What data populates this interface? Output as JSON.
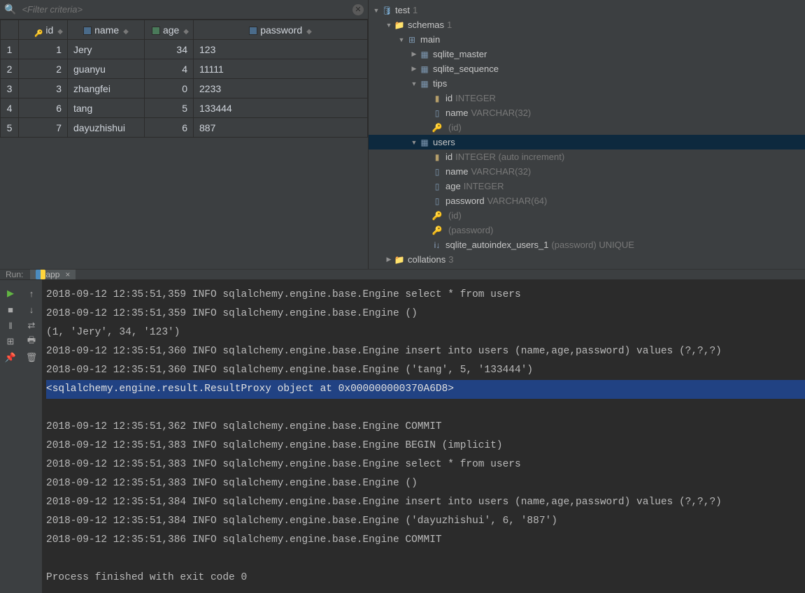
{
  "filter": {
    "placeholder": "<Filter criteria>"
  },
  "columns": [
    {
      "name": "id",
      "kind": "key"
    },
    {
      "name": "name",
      "kind": "col"
    },
    {
      "name": "age",
      "kind": "num"
    },
    {
      "name": "password",
      "kind": "col"
    }
  ],
  "rows": [
    {
      "n": "1",
      "id": "1",
      "name": "Jery",
      "age": "34",
      "password": "123"
    },
    {
      "n": "2",
      "id": "2",
      "name": "guanyu",
      "age": "4",
      "password": "11111"
    },
    {
      "n": "3",
      "id": "3",
      "name": "zhangfei",
      "age": "0",
      "password": "2233"
    },
    {
      "n": "4",
      "id": "6",
      "name": "tang",
      "age": "5",
      "password": "133444"
    },
    {
      "n": "5",
      "id": "7",
      "name": "dayuzhishui",
      "age": "6",
      "password": "887"
    }
  ],
  "tree": {
    "db": "test",
    "db_count": "1",
    "schemas": "schemas",
    "schemas_count": "1",
    "schema": "main",
    "tables": [
      "sqlite_master",
      "sqlite_sequence"
    ],
    "tips": {
      "name": "tips",
      "cols": [
        {
          "label": "id",
          "meta": "INTEGER",
          "icon": "key"
        },
        {
          "label": "name",
          "meta": "VARCHAR(32)",
          "icon": "col"
        },
        {
          "label": "<unnamed>",
          "meta": "(id)",
          "icon": "pk"
        }
      ]
    },
    "users": {
      "name": "users",
      "cols": [
        {
          "label": "id",
          "meta": "INTEGER (auto increment)",
          "icon": "key"
        },
        {
          "label": "name",
          "meta": "VARCHAR(32)",
          "icon": "col"
        },
        {
          "label": "age",
          "meta": "INTEGER",
          "icon": "col"
        },
        {
          "label": "password",
          "meta": "VARCHAR(64)",
          "icon": "col"
        },
        {
          "label": "<unnamed>",
          "meta": "(id)",
          "icon": "pk"
        },
        {
          "label": "<unnamed>",
          "meta": "(password)",
          "icon": "pk"
        },
        {
          "label": "sqlite_autoindex_users_1",
          "meta": "(password) UNIQUE",
          "icon": "idx"
        }
      ]
    },
    "collations": "collations",
    "collations_count": "3"
  },
  "run": {
    "label": "Run:",
    "tab": "app"
  },
  "console_lines": [
    {
      "t": "2018-09-12 12:35:51,359 INFO sqlalchemy.engine.base.Engine select * from users"
    },
    {
      "t": "2018-09-12 12:35:51,359 INFO sqlalchemy.engine.base.Engine ()"
    },
    {
      "t": "(1, 'Jery', 34, '123')"
    },
    {
      "t": "2018-09-12 12:35:51,360 INFO sqlalchemy.engine.base.Engine insert into users (name,age,password) values (?,?,?)"
    },
    {
      "t": "2018-09-12 12:35:51,360 INFO sqlalchemy.engine.base.Engine ('tang', 5, '133444')"
    },
    {
      "t": "<sqlalchemy.engine.result.ResultProxy object at 0x000000000370A6D8>",
      "hl": true
    },
    {
      "t": "2018-09-12 12:35:51,362 INFO sqlalchemy.engine.base.Engine COMMIT"
    },
    {
      "t": "2018-09-12 12:35:51,383 INFO sqlalchemy.engine.base.Engine BEGIN (implicit)"
    },
    {
      "t": "2018-09-12 12:35:51,383 INFO sqlalchemy.engine.base.Engine select * from users"
    },
    {
      "t": "2018-09-12 12:35:51,383 INFO sqlalchemy.engine.base.Engine ()"
    },
    {
      "t": "2018-09-12 12:35:51,384 INFO sqlalchemy.engine.base.Engine insert into users (name,age,password) values (?,?,?)"
    },
    {
      "t": "2018-09-12 12:35:51,384 INFO sqlalchemy.engine.base.Engine ('dayuzhishui', 6, '887')"
    },
    {
      "t": "2018-09-12 12:35:51,386 INFO sqlalchemy.engine.base.Engine COMMIT"
    },
    {
      "t": ""
    },
    {
      "t": "Process finished with exit code 0"
    }
  ]
}
